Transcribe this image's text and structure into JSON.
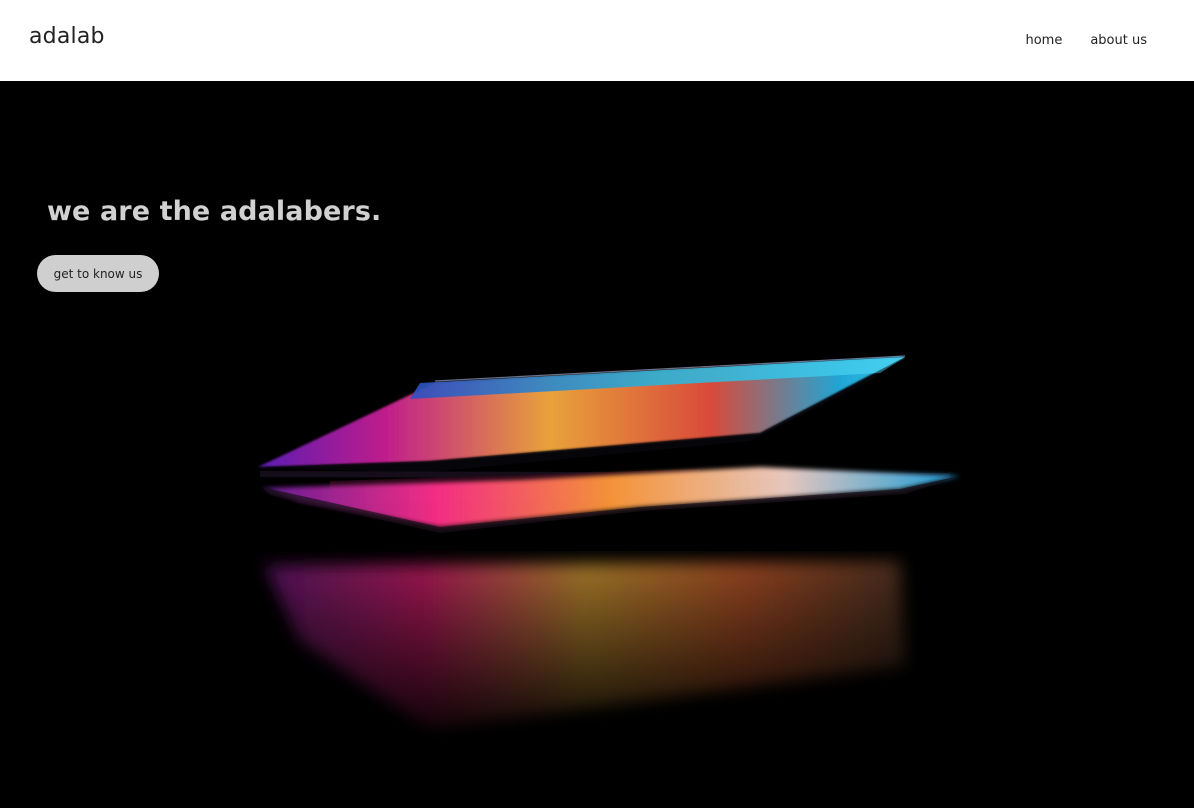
{
  "header": {
    "logo": "adalab",
    "nav": [
      "home",
      "about us"
    ]
  },
  "hero": {
    "headline": "we are the adalabers.",
    "cta_label": "get to know us"
  },
  "colors": {
    "header_bg": "#ffffff",
    "hero_bg": "#000000",
    "headline": "#d1d1d1",
    "button_bg": "#cfcfcf"
  }
}
